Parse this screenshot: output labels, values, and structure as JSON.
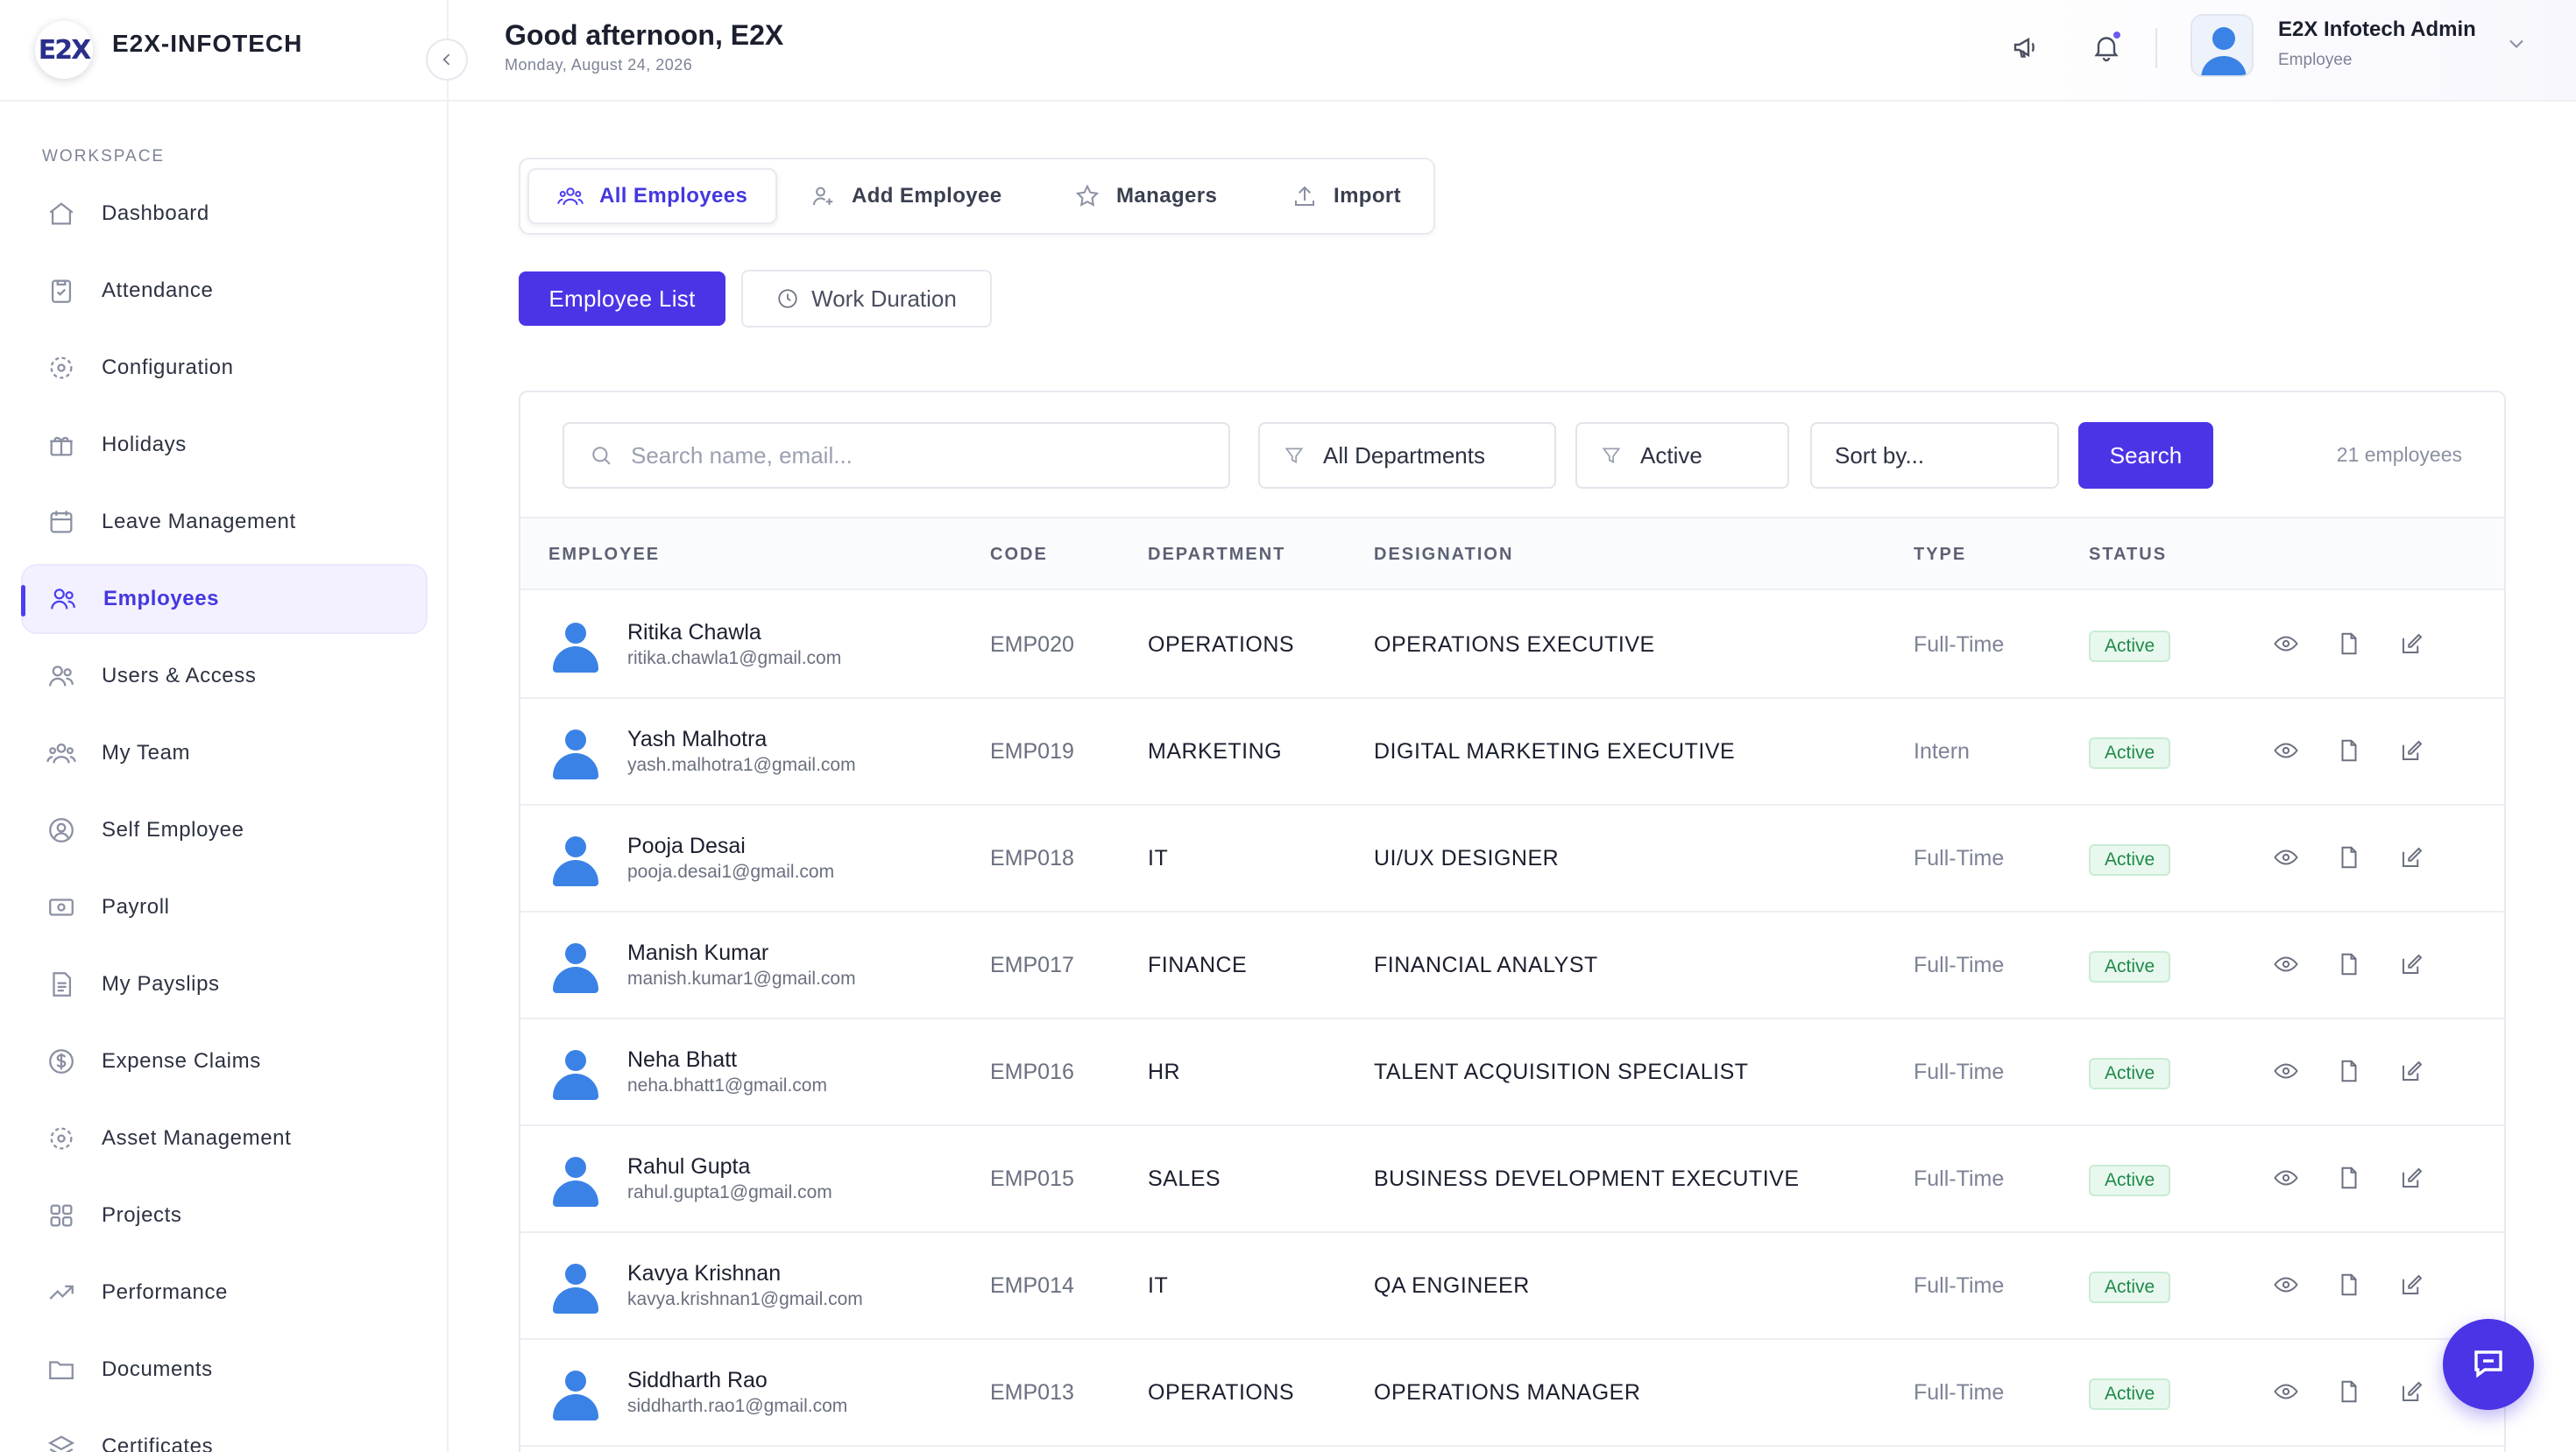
{
  "brand": {
    "name": "E2X-INFOTECH",
    "logo_text": "E2X"
  },
  "sidebar": {
    "section_label": "WORKSPACE",
    "items": [
      {
        "label": "Dashboard",
        "icon": "home-icon"
      },
      {
        "label": "Attendance",
        "icon": "clipboard-check-icon"
      },
      {
        "label": "Configuration",
        "icon": "settings-icon"
      },
      {
        "label": "Holidays",
        "icon": "gift-icon"
      },
      {
        "label": "Leave Management",
        "icon": "calendar-icon"
      },
      {
        "label": "Employees",
        "icon": "users-icon",
        "active": true
      },
      {
        "label": "Users & Access",
        "icon": "users-icon"
      },
      {
        "label": "My Team",
        "icon": "team-icon"
      },
      {
        "label": "Self Employee",
        "icon": "user-circle-icon"
      },
      {
        "label": "Payroll",
        "icon": "cash-icon"
      },
      {
        "label": "My Payslips",
        "icon": "file-text-icon"
      },
      {
        "label": "Expense Claims",
        "icon": "dollar-circle-icon"
      },
      {
        "label": "Asset Management",
        "icon": "settings-icon"
      },
      {
        "label": "Projects",
        "icon": "grid-icon"
      },
      {
        "label": "Performance",
        "icon": "trending-up-icon"
      },
      {
        "label": "Documents",
        "icon": "folder-icon"
      },
      {
        "label": "Certificates",
        "icon": "layers-icon"
      }
    ]
  },
  "header": {
    "greeting": "Good afternoon, E2X",
    "date": "Monday, August 24, 2026",
    "user_name": "E2X Infotech Admin",
    "user_role": "Employee"
  },
  "tabs": [
    {
      "label": "All Employees",
      "icon": "users-icon",
      "active": true
    },
    {
      "label": "Add Employee",
      "icon": "user-plus-icon"
    },
    {
      "label": "Managers",
      "icon": "star-icon"
    },
    {
      "label": "Import",
      "icon": "upload-icon"
    }
  ],
  "subtabs": {
    "primary": "Employee List",
    "secondary": "Work Duration"
  },
  "filters": {
    "search_placeholder": "Search name, email...",
    "department": "All Departments",
    "status": "Active",
    "sort": "Sort by...",
    "search_button": "Search",
    "count": "21 employees"
  },
  "table": {
    "columns": [
      "EMPLOYEE",
      "CODE",
      "DEPARTMENT",
      "DESIGNATION",
      "TYPE",
      "STATUS"
    ],
    "rows": [
      {
        "name": "Ritika Chawla",
        "email": "ritika.chawla1@gmail.com",
        "code": "EMP020",
        "department": "OPERATIONS",
        "designation": "OPERATIONS EXECUTIVE",
        "type": "Full-Time",
        "status": "Active"
      },
      {
        "name": "Yash Malhotra",
        "email": "yash.malhotra1@gmail.com",
        "code": "EMP019",
        "department": "MARKETING",
        "designation": "DIGITAL MARKETING EXECUTIVE",
        "type": "Intern",
        "status": "Active"
      },
      {
        "name": "Pooja Desai",
        "email": "pooja.desai1@gmail.com",
        "code": "EMP018",
        "department": "IT",
        "designation": "UI/UX DESIGNER",
        "type": "Full-Time",
        "status": "Active"
      },
      {
        "name": "Manish Kumar",
        "email": "manish.kumar1@gmail.com",
        "code": "EMP017",
        "department": "FINANCE",
        "designation": "FINANCIAL ANALYST",
        "type": "Full-Time",
        "status": "Active"
      },
      {
        "name": "Neha Bhatt",
        "email": "neha.bhatt1@gmail.com",
        "code": "EMP016",
        "department": "HR",
        "designation": "TALENT ACQUISITION SPECIALIST",
        "type": "Full-Time",
        "status": "Active"
      },
      {
        "name": "Rahul Gupta",
        "email": "rahul.gupta1@gmail.com",
        "code": "EMP015",
        "department": "SALES",
        "designation": "BUSINESS DEVELOPMENT EXECUTIVE",
        "type": "Full-Time",
        "status": "Active"
      },
      {
        "name": "Kavya Krishnan",
        "email": "kavya.krishnan1@gmail.com",
        "code": "EMP014",
        "department": "IT",
        "designation": "QA ENGINEER",
        "type": "Full-Time",
        "status": "Active"
      },
      {
        "name": "Siddharth Rao",
        "email": "siddharth.rao1@gmail.com",
        "code": "EMP013",
        "department": "OPERATIONS",
        "designation": "OPERATIONS MANAGER",
        "type": "Full-Time",
        "status": "Active"
      }
    ]
  },
  "colors": {
    "accent": "#4b34e6",
    "status_active": "#1f8a4a",
    "status_active_bg": "#e9f8ee"
  }
}
